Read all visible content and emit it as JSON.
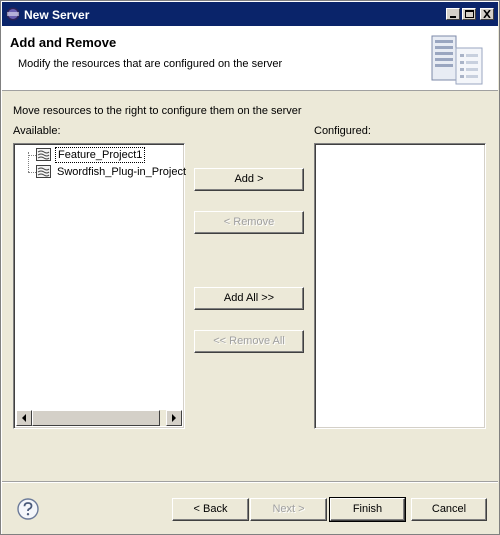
{
  "window": {
    "title": "New Server"
  },
  "header": {
    "title": "Add and Remove",
    "description": "Modify the resources that are configured on the server"
  },
  "content": {
    "instruction": "Move resources to the right to configure them on the server",
    "available_label": "Available:",
    "configured_label": "Configured:",
    "available_items": [
      {
        "label": "Feature_Project1",
        "selected": true
      },
      {
        "label": "Swordfish_Plug-in_Project",
        "selected": false
      }
    ],
    "configured_items": []
  },
  "buttons": {
    "add": "Add >",
    "remove": "< Remove",
    "add_all": "Add All >>",
    "remove_all": "<< Remove All",
    "back": "< Back",
    "next": "Next >",
    "finish": "Finish",
    "cancel": "Cancel"
  },
  "icons": {
    "app": "eclipse-icon",
    "wizard": "server-wizard-icon",
    "project": "project-icon",
    "help": "help-icon"
  }
}
